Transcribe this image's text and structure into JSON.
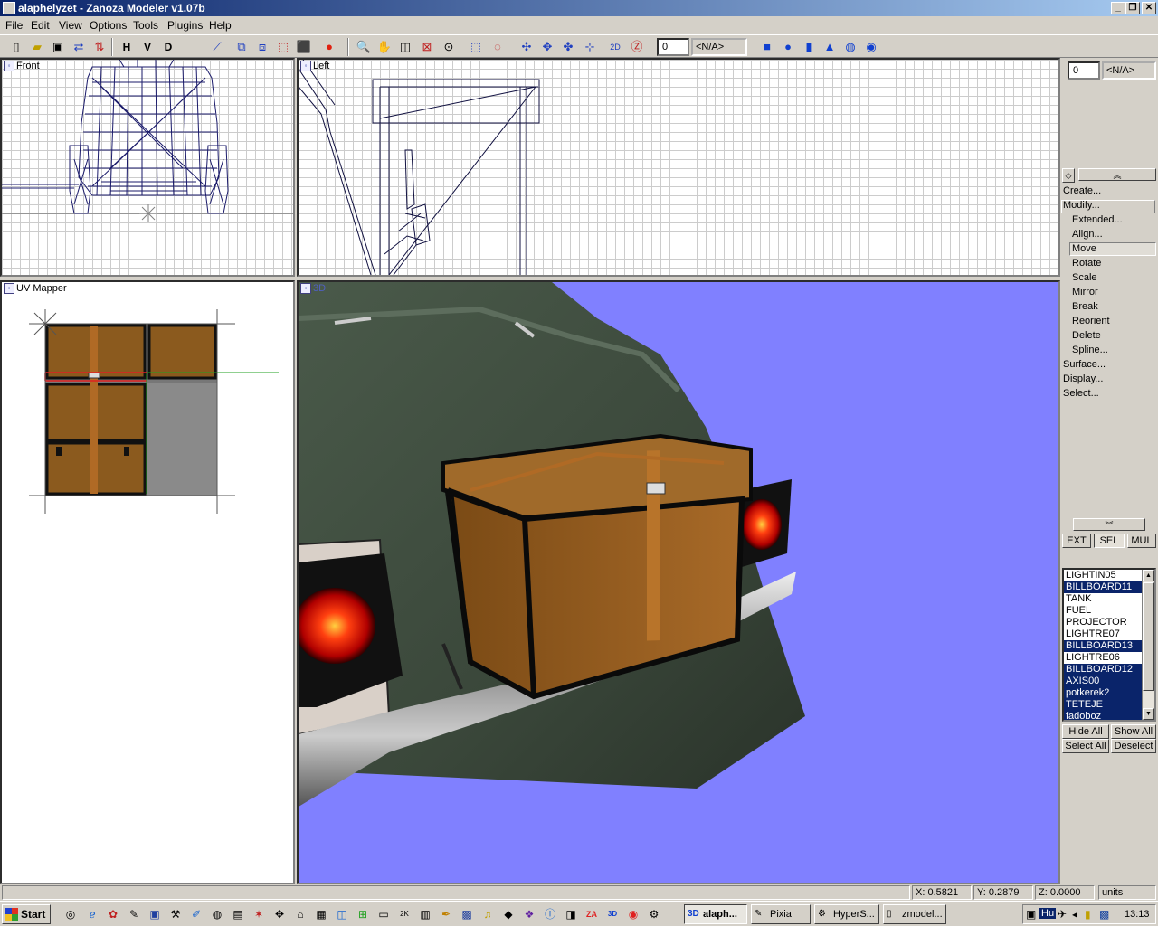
{
  "window": {
    "title": "alaphelyzet - Zanoza Modeler v1.07b"
  },
  "menu": [
    "File",
    "Edit",
    "View",
    "Options",
    "Tools",
    "Plugins",
    "Help"
  ],
  "toolbar": {
    "letters": [
      "H",
      "V",
      "D"
    ],
    "spin_value": "0",
    "na_value": "<N/A>"
  },
  "viewports": {
    "front": "Front",
    "left": "Left",
    "uv": "UV Mapper",
    "threed": "3D"
  },
  "panel": {
    "spin_value": "0",
    "na_value": "<N/A>",
    "create": "Create...",
    "modify": "Modify...",
    "sub_items": [
      "Extended...",
      "Align...",
      "Move",
      "Rotate",
      "Scale",
      "Mirror",
      "Break",
      "Reorient",
      "Delete",
      "Spline..."
    ],
    "other_items": [
      "Surface...",
      "Display...",
      "Select..."
    ],
    "tabs": [
      "EXT",
      "SEL",
      "MUL"
    ],
    "objects": [
      {
        "name": "LIGHTIN05",
        "selected": false
      },
      {
        "name": "BILLBOARD11",
        "selected": true
      },
      {
        "name": "TANK",
        "selected": false
      },
      {
        "name": "FUEL",
        "selected": false
      },
      {
        "name": "PROJECTOR",
        "selected": false
      },
      {
        "name": "LIGHTRE07",
        "selected": false
      },
      {
        "name": "BILLBOARD13",
        "selected": true
      },
      {
        "name": "LIGHTRE06",
        "selected": false
      },
      {
        "name": "BILLBOARD12",
        "selected": true
      },
      {
        "name": "AXIS00",
        "selected": true
      },
      {
        "name": "potkerek2",
        "selected": true
      },
      {
        "name": "TETEJE",
        "selected": true
      },
      {
        "name": "fadoboz",
        "selected": true
      }
    ],
    "hide_all": "Hide All",
    "show_all": "Show All",
    "select_all": "Select All",
    "deselect": "Deselect"
  },
  "status": {
    "x": "X: 0.5821",
    "y": "Y: 0.2879",
    "z": "Z: 0.0000",
    "units": "units"
  },
  "taskbar": {
    "start": "Start",
    "tasks": [
      "alaph...",
      "Pixia",
      "HyperS...",
      "zmodel..."
    ],
    "clock": "13:13",
    "lang": "Hu"
  },
  "colors": {
    "title_start": "#0a246a",
    "title_end": "#a6caf0",
    "sky": "#8080ff",
    "selection": "#0a246a"
  }
}
